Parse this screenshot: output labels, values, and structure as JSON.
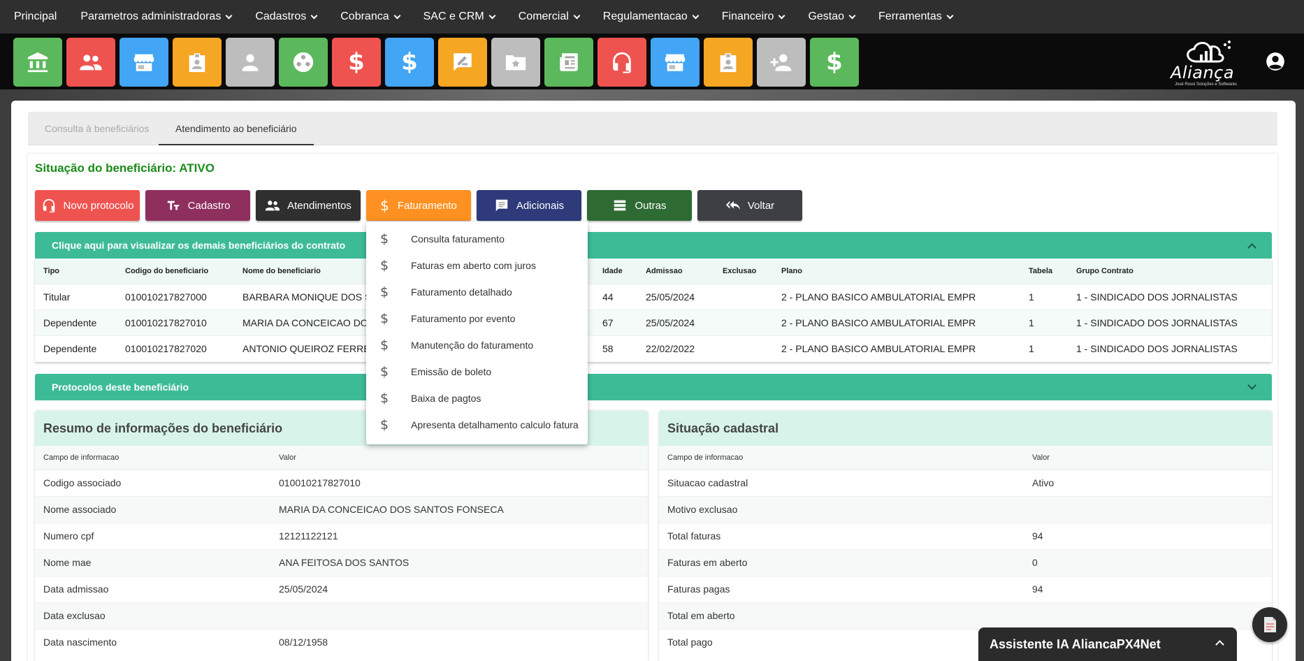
{
  "topnav": {
    "items": [
      {
        "label": "Principal",
        "dropdown": false
      },
      {
        "label": "Parametros administradoras",
        "dropdown": true
      },
      {
        "label": "Cadastros",
        "dropdown": true
      },
      {
        "label": "Cobranca",
        "dropdown": true
      },
      {
        "label": "SAC e CRM",
        "dropdown": true
      },
      {
        "label": "Comercial",
        "dropdown": true
      },
      {
        "label": "Regulamentacao",
        "dropdown": true
      },
      {
        "label": "Financeiro",
        "dropdown": true
      },
      {
        "label": "Gestao",
        "dropdown": true
      },
      {
        "label": "Ferramentas",
        "dropdown": true
      }
    ]
  },
  "tiles": [
    {
      "icon": "bank-icon",
      "color": "#5cb85c"
    },
    {
      "icon": "group-icon",
      "color": "#ef5350"
    },
    {
      "icon": "store-icon",
      "color": "#42a5f5"
    },
    {
      "icon": "badge-icon",
      "color": "#f5a623"
    },
    {
      "icon": "person-icon",
      "color": "#bdbdbd"
    },
    {
      "icon": "film-reel-icon",
      "color": "#5cb85c"
    },
    {
      "icon": "dollar-icon",
      "color": "#ef5350"
    },
    {
      "icon": "dollar-icon",
      "color": "#42a5f5"
    },
    {
      "icon": "edit-note-icon",
      "color": "#f5a623"
    },
    {
      "icon": "folder-star-icon",
      "color": "#bdbdbd"
    },
    {
      "icon": "newspaper-icon",
      "color": "#5cb85c"
    },
    {
      "icon": "headset-icon",
      "color": "#ef5350"
    },
    {
      "icon": "store-icon",
      "color": "#42a5f5"
    },
    {
      "icon": "badge-icon",
      "color": "#f5a623"
    },
    {
      "icon": "person-add-icon",
      "color": "#bdbdbd"
    },
    {
      "icon": "dollar-icon",
      "color": "#5cb85c"
    }
  ],
  "logo": {
    "text": "Aliança",
    "subtitle": "José Rossi Soluções e Softwares"
  },
  "tabs": {
    "consulta": "Consulta à beneficiários",
    "atendimento": "Atendimento ao beneficiário"
  },
  "status": {
    "text": "Situação do beneficiário: ATIVO",
    "color": "#1a8a1a"
  },
  "actions": [
    {
      "label": "Novo protocolo",
      "icon": "headset-icon",
      "color": "#ef5350"
    },
    {
      "label": "Cadastro",
      "icon": "text-format-icon",
      "color": "#8e2f5e"
    },
    {
      "label": "Atendimentos",
      "icon": "group-icon",
      "color": "#2f2f2f"
    },
    {
      "label": "Faturamento",
      "icon": "dollar-icon",
      "color": "#ff9122"
    },
    {
      "label": "Adicionais",
      "icon": "chat-icon",
      "color": "#2e3a7a"
    },
    {
      "label": "Outras",
      "icon": "list-icon",
      "color": "#2e6b33"
    },
    {
      "label": "Voltar",
      "icon": "reply-all-icon",
      "color": "#3d3f44"
    }
  ],
  "faturamento_menu": [
    "Consulta faturamento",
    "Faturas em aberto com juros",
    "Faturamento detalhado",
    "Faturamento por evento",
    "Manutenção do faturamento",
    "Emissão de boleto",
    "Baixa de pagtos",
    "Apresenta detalhamento calculo fatura"
  ],
  "beneficiarios": {
    "header": "Clique aqui para visualizar os demais beneficiários do contrato",
    "columns": [
      "Tipo",
      "Codigo do beneficiario",
      "Nome do beneficiario",
      "Idade",
      "Admissao",
      "Exclusao",
      "Plano",
      "Tabela",
      "Grupo Contrato"
    ],
    "rows": [
      [
        "Titular",
        "010010217827000",
        "BARBARA MONIQUE DOS S",
        "44",
        "25/05/2024",
        "",
        "2 - PLANO BASICO AMBULATORIAL EMPR",
        "1",
        "1 - SINDICADO DOS JORNALISTAS"
      ],
      [
        "Dependente",
        "010010217827010",
        "MARIA DA CONCEICAO DO",
        "67",
        "25/05/2024",
        "",
        "2 - PLANO BASICO AMBULATORIAL EMPR",
        "1",
        "1 - SINDICADO DOS JORNALISTAS"
      ],
      [
        "Dependente",
        "010010217827020",
        "ANTONIO QUEIROZ FERRE",
        "58",
        "22/02/2022",
        "",
        "2 - PLANO BASICO AMBULATORIAL EMPR",
        "1",
        "1 - SINDICADO DOS JORNALISTAS"
      ]
    ]
  },
  "protocolos": {
    "header": "Protocolos deste beneficiário"
  },
  "resumo": {
    "title": "Resumo de informações do beneficiário",
    "columns": [
      "Campo de informacao",
      "Valor"
    ],
    "rows": [
      [
        "Codigo associado",
        "010010217827010"
      ],
      [
        "Nome associado",
        "MARIA DA CONCEICAO DOS SANTOS FONSECA"
      ],
      [
        "Numero cpf",
        "12121122121"
      ],
      [
        "Nome mae",
        "ANA FEITOSA DOS SANTOS"
      ],
      [
        "Data admissao",
        "25/05/2024"
      ],
      [
        "Data exclusao",
        ""
      ],
      [
        "Data nascimento",
        "08/12/1958"
      ]
    ]
  },
  "situacao": {
    "title": "Situação cadastral",
    "columns": [
      "Campo de informacao",
      "Valor"
    ],
    "rows": [
      [
        "Situacao cadastral",
        "Ativo"
      ],
      [
        "Motivo exclusao",
        ""
      ],
      [
        "Total faturas",
        "94"
      ],
      [
        "Faturas em aberto",
        "0"
      ],
      [
        "Faturas pagas",
        "94"
      ],
      [
        "Total em aberto",
        ""
      ],
      [
        "Total pago",
        ""
      ]
    ]
  },
  "assistant": {
    "label": "Assistente IA AliancaPX4Net"
  }
}
